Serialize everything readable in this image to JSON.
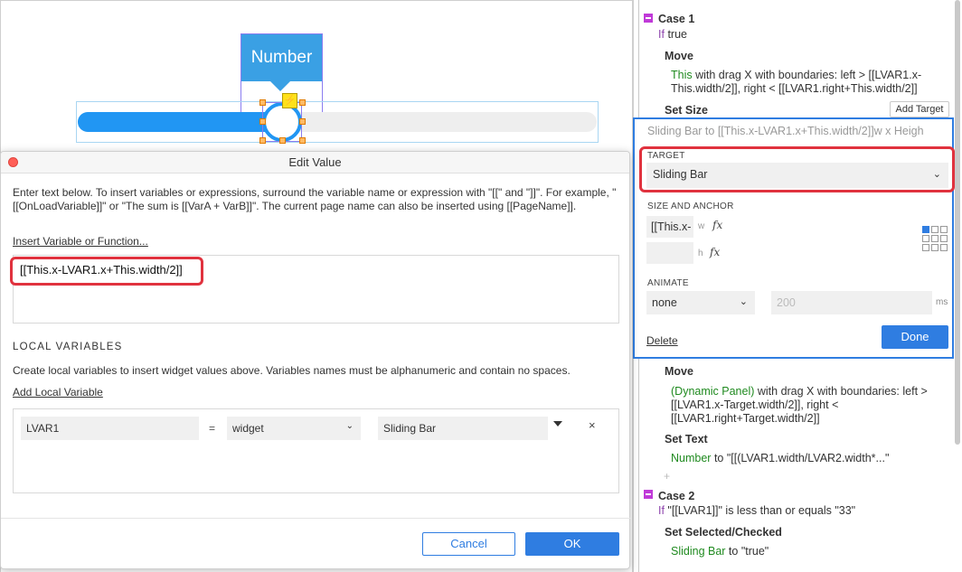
{
  "canvas": {
    "tooltip_label": "Number"
  },
  "dialog": {
    "title": "Edit Value",
    "description": "Enter text below. To insert variables or expressions, surround the variable name or expression with \"[[\" and \"]]\". For example, \"[[OnLoadVariable]]\" or \"The sum is [[VarA + VarB]]\". The current page name can also be inserted using [[PageName]].",
    "insert_link": "Insert Variable or Function...",
    "expression": "[[This.x-LVAR1.x+This.width/2]]",
    "local_vars_heading": "LOCAL VARIABLES",
    "local_vars_desc": "Create local variables to insert widget values above. Variables names must be alphanumeric and contain no spaces.",
    "add_local_link": "Add Local Variable",
    "local_var": {
      "name": "LVAR1",
      "equals": "=",
      "type": "widget",
      "target": "Sliding Bar",
      "delete": "×"
    },
    "cancel_label": "Cancel",
    "ok_label": "OK"
  },
  "panel": {
    "case1": {
      "title": "Case 1",
      "if_kw": "If",
      "condition": "true"
    },
    "move1": {
      "title": "Move",
      "target": "This",
      "line1": " with drag X  with boundaries: left > [[LVAR1.x-",
      "line2": "This.width/2]], right < [[LVAR1.right+This.width/2]]"
    },
    "set_size": {
      "title": "Set Size",
      "add_target": "Add Target"
    },
    "editor": {
      "summary": "Sliding Bar to [[This.x-LVAR1.x+This.width/2]]w x Heigh",
      "target_label": "TARGET",
      "target_value": "Sliding Bar",
      "size_label": "SIZE AND ANCHOR",
      "width_value": "[[This.x-",
      "w": "w",
      "h": "h",
      "fx": "fx",
      "animate_label": "ANIMATE",
      "animate_value": "none",
      "duration": "200",
      "ms": "ms",
      "delete": "Delete",
      "done": "Done"
    },
    "move2": {
      "title": "Move",
      "target": "(Dynamic Panel)",
      "line1": " with drag X  with boundaries: left >",
      "line2": "[[LVAR1.x-Target.width/2]], right <",
      "line3": "[[LVAR1.right+Target.width/2]]"
    },
    "set_text": {
      "title": "Set Text",
      "target": "Number",
      "value": " to \"[[(LVAR1.width/LVAR2.width*...\""
    },
    "plus": "+",
    "case2": {
      "title": "Case 2",
      "if_kw": "If",
      "condition": " \"[[LVAR1]]\" is less than or equals \"33\""
    },
    "set_selected": {
      "title": "Set Selected/Checked",
      "target": "Sliding Bar",
      "value": " to \"true\""
    }
  },
  "colors": {
    "accent": "#2f7de1",
    "slider": "#2196f3",
    "highlight": "#e0323e",
    "case_marker": "#c03ad8",
    "target_green": "#1f8a1f"
  }
}
